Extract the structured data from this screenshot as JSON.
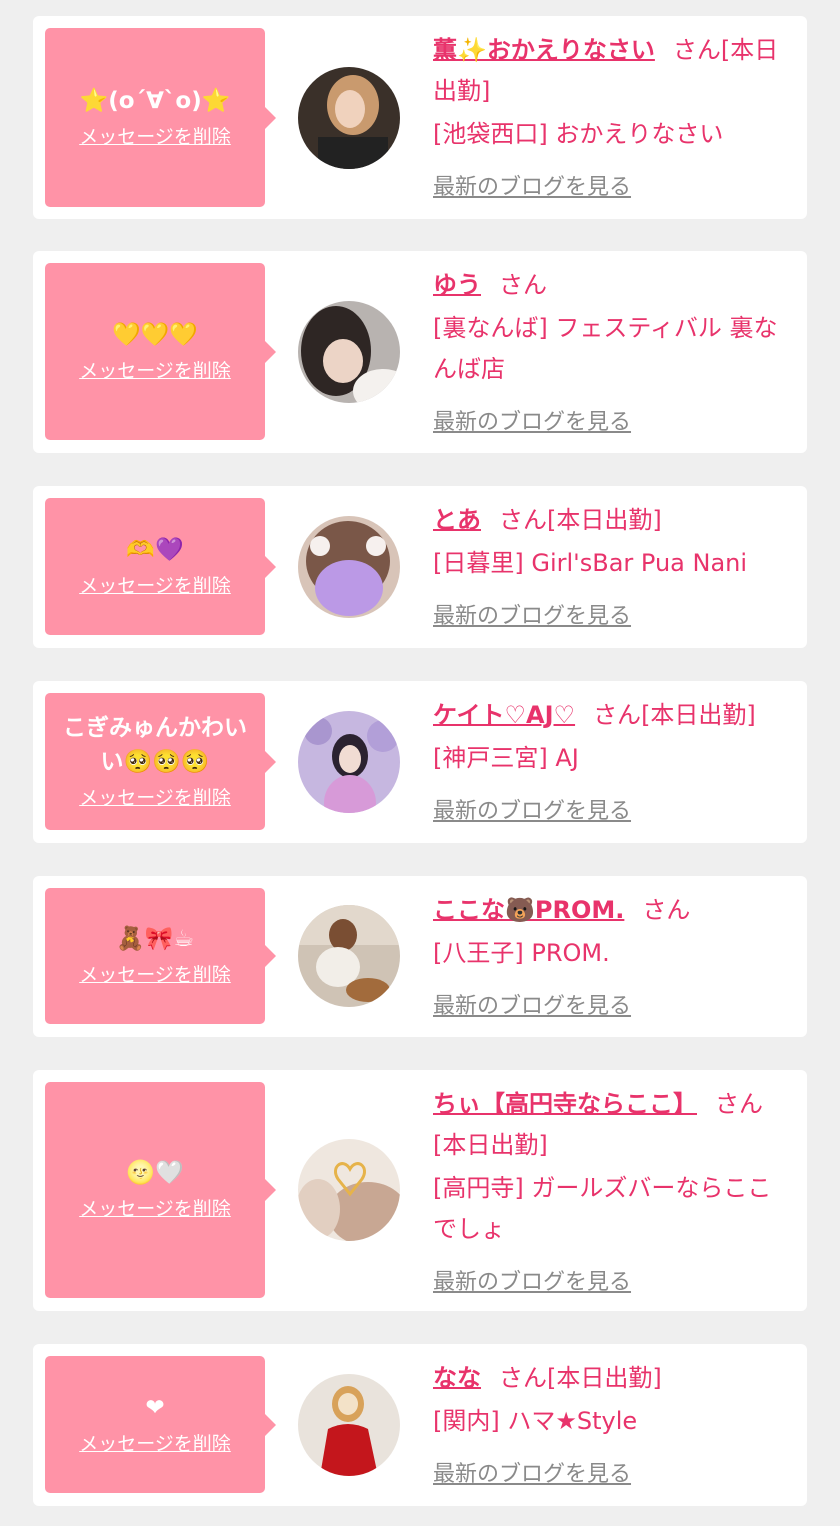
{
  "delete_label": "メッセージを削除",
  "blog_label": "最新のブログを見る",
  "san_suffix": "さん",
  "entries": [
    {
      "message": "⭐(o´∀`o)⭐",
      "name": "薫✨おかえりなさい",
      "status": "[本日出勤]",
      "shop": "[池袋西口] おかえりなさい"
    },
    {
      "message": "💛💛💛",
      "name": "ゆう",
      "status": "",
      "shop": "[裏なんば] フェスティバル 裏なんば店"
    },
    {
      "message": "🫶💜",
      "name": "とあ",
      "status": "[本日出勤]",
      "shop": "[日暮里] Girl'sBar Pua Nani"
    },
    {
      "message": "こぎみゅんかわいい🥺🥺🥺",
      "name": "ケイト♡AJ♡",
      "status": "[本日出勤]",
      "shop": "[神戸三宮] AJ"
    },
    {
      "message": "🧸🎀☕",
      "name": "ここな🐻PROM.",
      "status": "",
      "shop": "[八王子] PROM."
    },
    {
      "message": "🌝🤍",
      "name": "ちぃ【高円寺ならここ】",
      "status": "[本日出勤]",
      "shop": "[高円寺] ガールズバーならここでしょ"
    },
    {
      "message": "❤",
      "name": "なな",
      "status": "[本日出勤]",
      "shop": "[関内] ハマ★Style"
    }
  ],
  "colors": {
    "page_bg": "#efefef",
    "card_bg": "#ffffff",
    "bubble_bg": "#ff93a7",
    "name_color": "#e8336b",
    "link_gray": "#8a8a8a"
  }
}
